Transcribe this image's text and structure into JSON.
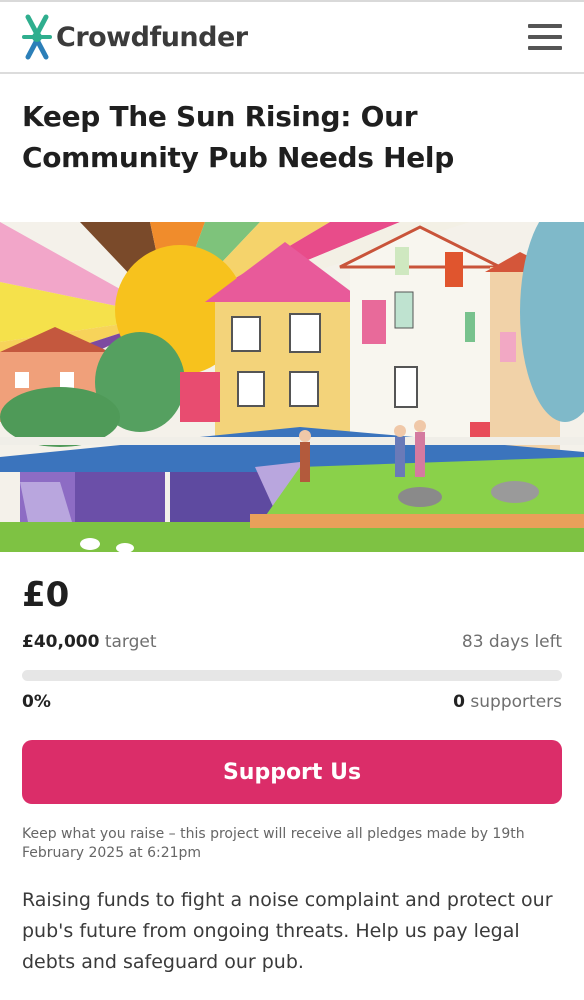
{
  "header": {
    "brand_name": "Crowdfunder",
    "logo_icon": "crowdfunder-x-logo",
    "menu_icon": "hamburger-menu-icon"
  },
  "project": {
    "title": "Keep The Sun Rising: Our Community Pub Needs Help",
    "image_alt": "Colourful illustration of a pub by a canal lock with a rising sun"
  },
  "funding": {
    "raised": "£0",
    "target_amount": "£40,000",
    "target_label": "target",
    "days_left": "83 days left",
    "percent": "0%",
    "progress_fraction": 0,
    "supporters_count": "0",
    "supporters_label": "supporters"
  },
  "cta": {
    "support_label": "Support Us"
  },
  "info": {
    "keep_what_you_raise": "Keep what you raise – this project will receive all pledges made by 19th February 2025 at 6:21pm"
  },
  "description": {
    "summary": "Raising funds to fight a noise complaint and protect our pub's future from ongoing threats. Help us pay legal debts and safeguard our pub."
  },
  "colors": {
    "accent": "#db2d69",
    "logo_green": "#2fae8e",
    "logo_blue": "#2c7fb8"
  }
}
